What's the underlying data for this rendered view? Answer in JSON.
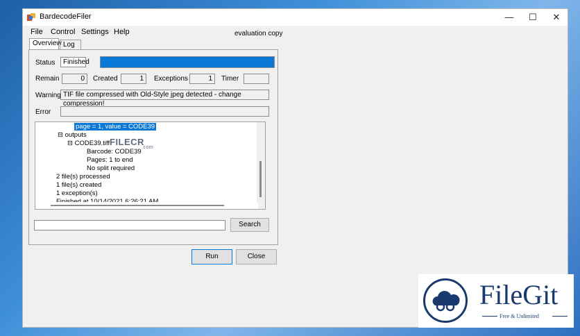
{
  "window": {
    "title": "BardecodeFiler",
    "minimize": "—",
    "maximize": "☐",
    "close": "✕"
  },
  "menu": {
    "file": "File",
    "control": "Control",
    "settings": "Settings",
    "help": "Help"
  },
  "evaluation_label": "evaluation copy",
  "tabs": {
    "overview": "Overview",
    "log": "Log"
  },
  "status": {
    "label": "Status",
    "value": "Finished",
    "progress_percent": 100
  },
  "counts": {
    "remain_label": "Remain",
    "remain_value": "0",
    "created_label": "Created",
    "created_value": "1",
    "exceptions_label": "Exceptions",
    "exceptions_value": "1",
    "timer_label": "Timer",
    "timer_value": ""
  },
  "warning": {
    "label": "Warning",
    "value": "TIF file compressed with Old-Style jpeg detected - change compression!"
  },
  "error": {
    "label": "Error",
    "value": ""
  },
  "tree": {
    "lines": [
      "page = 1, value = CODE39",
      "⊟ outputs",
      "⊟ CODE39.tiff",
      "Barcode: CODE39",
      "Pages: 1 to end",
      "No split required",
      "2 file(s) processed",
      "1 file(s) created",
      "1 exception(s)",
      "Finished at 10/14/2021 6:26:21 AM"
    ]
  },
  "search": {
    "value": "",
    "button": "Search"
  },
  "buttons": {
    "run": "Run",
    "close": "Close"
  },
  "watermark": {
    "text": "FILECR",
    "sub": ".com"
  },
  "badge": {
    "name": "FileGit",
    "tagline": "Free & Unlimited"
  },
  "colors": {
    "accent": "#0a78d7",
    "brand": "#1a3a6e"
  }
}
